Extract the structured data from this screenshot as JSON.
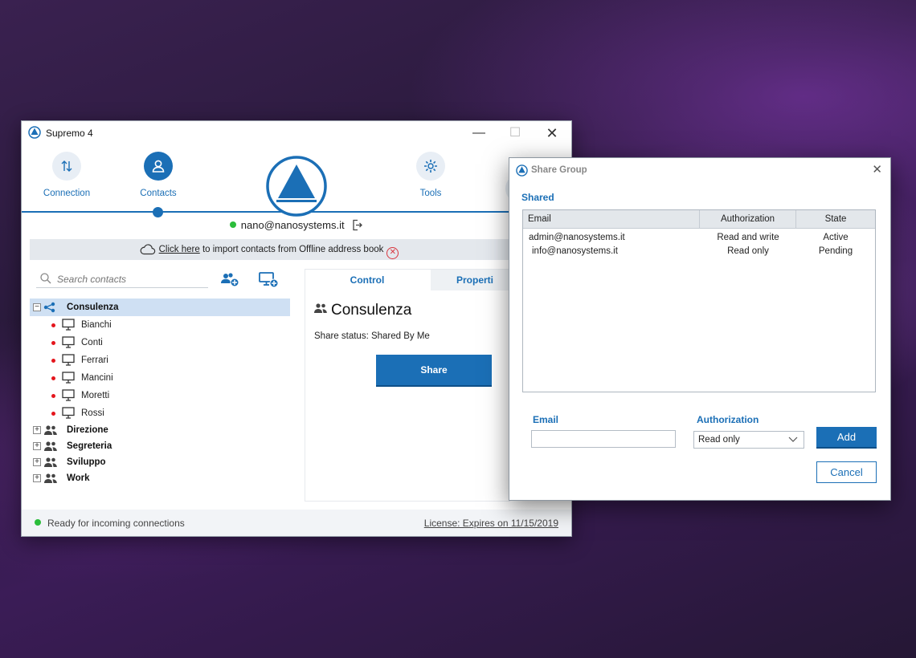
{
  "main_window": {
    "title": "Supremo 4",
    "controls": {
      "minimize": "—",
      "maximize": "☐",
      "close": "✕"
    },
    "nav": {
      "connection_label": "Connection",
      "contacts_label": "Contacts",
      "tools_label": "Tools"
    },
    "user_email": "nano@nanosystems.it",
    "import_bar": {
      "link_text": "Click here",
      "rest_text": " to import contacts from Offline address book"
    },
    "search": {
      "placeholder": "Search contacts"
    },
    "tree": {
      "groups": [
        {
          "label": "Consulenza",
          "expanded": true,
          "expander": "−",
          "children": [
            "Bianchi",
            "Conti",
            "Ferrari",
            "Mancini",
            "Moretti",
            "Rossi"
          ]
        },
        {
          "label": "Direzione",
          "expander": "+"
        },
        {
          "label": "Segreteria",
          "expander": "+"
        },
        {
          "label": "Sviluppo",
          "expander": "+"
        },
        {
          "label": "Work",
          "expander": "+"
        }
      ]
    },
    "detail": {
      "tabs": {
        "control": "Control",
        "properties": "Properti"
      },
      "title": "Consulenza",
      "share_status": "Share status: Shared By Me",
      "share_button": "Share"
    },
    "status": {
      "text": "Ready for incoming connections",
      "license": "License: Expires on 11/15/2019"
    },
    "colors": {
      "accent": "#1b6fb6",
      "online": "#2bbd3b",
      "offline": "#e4161d"
    }
  },
  "dialog": {
    "title": "Share Group",
    "close": "✕",
    "section_title": "Shared",
    "table": {
      "headers": {
        "email": "Email",
        "authorization": "Authorization",
        "state": "State"
      },
      "rows": [
        {
          "email": "admin@nanosystems.it",
          "authorization": "Read and write",
          "state": "Active"
        },
        {
          "email": "info@nanosystems.it",
          "authorization": "Read only",
          "state": "Pending"
        }
      ]
    },
    "form": {
      "email_label": "Email",
      "email_value": "",
      "authorization_label": "Authorization",
      "authorization_value": "Read only",
      "add_button": "Add",
      "cancel_button": "Cancel"
    }
  }
}
